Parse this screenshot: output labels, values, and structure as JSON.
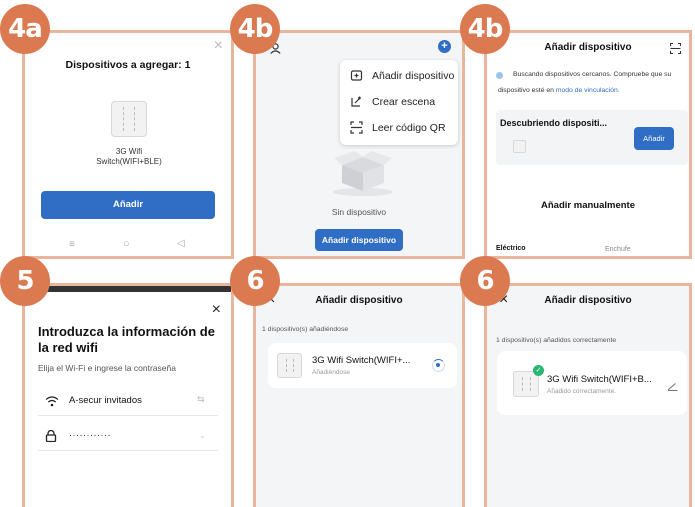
{
  "badges": [
    "4a",
    "4b",
    "4b",
    "5",
    "6",
    "6"
  ],
  "panel_4a": {
    "title": "Dispositivos a agregar: 1",
    "device_name": "3G Wifi Switch(WIFI+BLE)",
    "add_button": "Añadir",
    "close_glyph": "×",
    "nav": {
      "menu": "≡",
      "home": "○",
      "back": "◁"
    }
  },
  "panel_4b_home": {
    "menu": [
      {
        "icon": "add-device-icon",
        "label": "Añadir dispositivo"
      },
      {
        "icon": "create-scene-icon",
        "label": "Crear escena"
      },
      {
        "icon": "scan-qr-icon",
        "label": "Leer código QR"
      }
    ],
    "empty_text": "Sin dispositivo",
    "add_button": "Añadir dispositivo"
  },
  "panel_4b_scan": {
    "title": "Añadir dispositivo",
    "info_text_1": "Buscando dispositivos cercanos. Compruebe que su",
    "info_text_2": "dispositivo esté en",
    "info_link": "modo de vinculación.",
    "discovering_label": "Descubriendo dispositi...",
    "add_button": "Añadir",
    "manual_title": "Añadir manualmente",
    "categories": [
      "Eléctrico",
      "Enchufe"
    ]
  },
  "panel_5": {
    "close_glyph": "×",
    "title": "Introduzca la información de la red wifi",
    "subtitle": "Elija el Wi-Fi e ingrese la contraseña",
    "wifi_name": "A-secur invitados",
    "password_mask": "············"
  },
  "panel_6a": {
    "close_glyph": "×",
    "title": "Añadir dispositivo",
    "status_line": "1 dispositivo(s) añadiéndose",
    "device_name": "3G Wifi Switch(WIFI+...",
    "device_status": "Añadiéndose"
  },
  "panel_6b": {
    "close_glyph": "×",
    "title": "Añadir dispositivo",
    "status_line": "1 dispositivo(s) añadidos correctamente",
    "device_name": "3G Wifi Switch(WIFI+B...",
    "device_status": "Añadido correctamente."
  },
  "colors": {
    "badge": "#db7a50",
    "frame": "#eab69b",
    "primary": "#2f6ec4",
    "success": "#2bb673"
  }
}
